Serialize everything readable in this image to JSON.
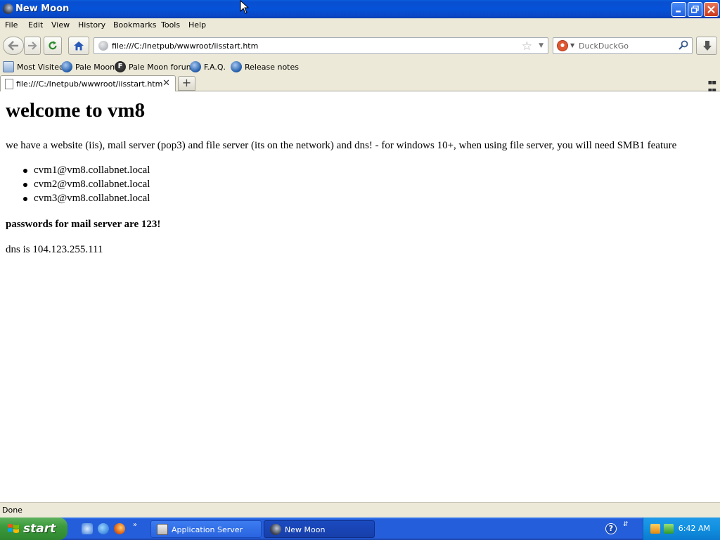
{
  "window": {
    "title": "New Moon"
  },
  "menu": {
    "items": [
      "File",
      "Edit",
      "View",
      "History",
      "Bookmarks",
      "Tools",
      "Help"
    ]
  },
  "navigation": {
    "url": "file:///C:/Inetpub/wwwroot/iisstart.htm",
    "search_placeholder": "DuckDuckGo"
  },
  "bookmarks": {
    "items": [
      "Most Visited",
      "Pale Moon",
      "Pale Moon forum",
      "F.A.Q.",
      "Release notes"
    ]
  },
  "tabs": {
    "items": [
      {
        "title": "file:///C:/Inetpub/wwwroot/iisstart.htm"
      }
    ]
  },
  "page": {
    "heading": "welcome to vm8",
    "intro": "we have a website (iis), mail server (pop3) and file server (its on the network) and dns! - for windows 10+, when using file server, you will need SMB1 feature",
    "emails": [
      "cvm1@vm8.collabnet.local",
      "cvm2@vm8.collabnet.local",
      "cvm3@vm8.collabnet.local"
    ],
    "password_note": "passwords for mail server are 123!",
    "dns_note": "dns is 104.123.255.111"
  },
  "status": {
    "text": "Done"
  },
  "taskbar": {
    "start_label": "start",
    "tasks": [
      "Application Server",
      "New Moon"
    ],
    "clock": "6:42 AM"
  },
  "colors": {
    "titlebar": "#0552d8",
    "taskbar": "#245edb",
    "start_button": "#3c9a3c",
    "tray": "#1290e0"
  }
}
